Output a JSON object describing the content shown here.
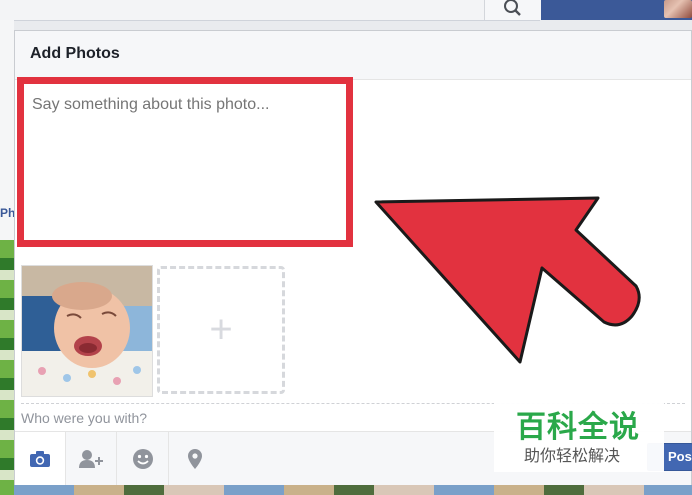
{
  "dialog": {
    "title": "Add Photos",
    "composer_placeholder": "Say something about this photo...",
    "with_placeholder": "Who were you with?",
    "add_tile_symbol": "+",
    "post_label": "Post"
  },
  "toolbar": {
    "items": [
      {
        "icon": "camera-icon"
      },
      {
        "icon": "tag-friends-icon"
      },
      {
        "icon": "feeling-icon"
      },
      {
        "icon": "location-icon"
      }
    ]
  },
  "background": {
    "ph_text": "Ph"
  },
  "watermark": {
    "main": "百科全说",
    "sub": "助你轻松解决"
  },
  "colors": {
    "brand": "#3b5998",
    "annotation_red": "#e2323f",
    "post_button": "#4267b2",
    "watermark_green": "#2aa84a"
  }
}
